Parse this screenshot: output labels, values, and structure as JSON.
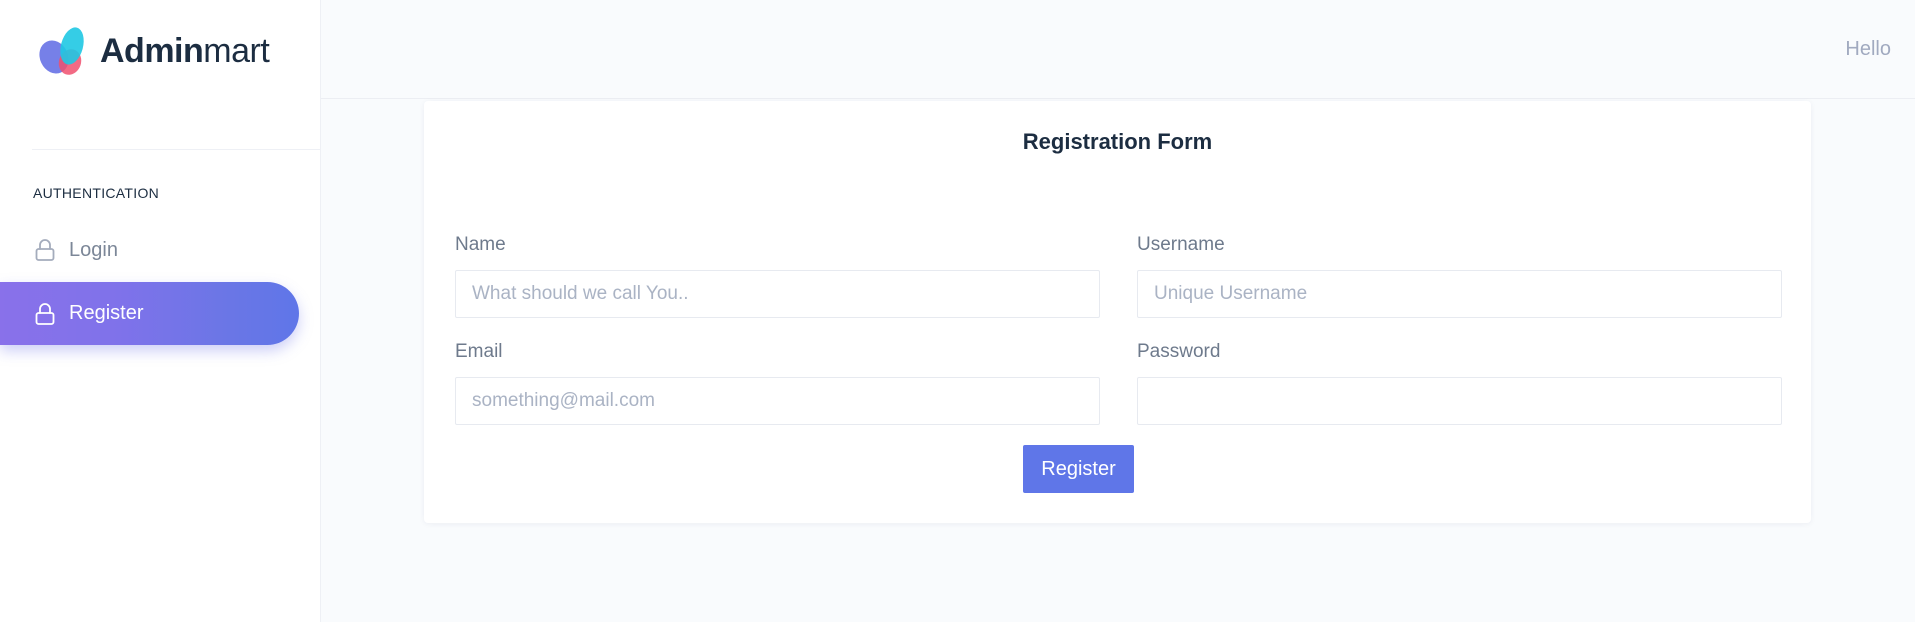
{
  "brand": {
    "name_bold": "Admin",
    "name_light": "mart"
  },
  "sidebar": {
    "heading": "AUTHENTICATION",
    "items": [
      {
        "label": "Login",
        "icon": "lock-icon",
        "active": false
      },
      {
        "label": "Register",
        "icon": "lock-icon",
        "active": true
      }
    ]
  },
  "topbar": {
    "greeting": "Hello"
  },
  "form": {
    "title": "Registration Form",
    "fields": {
      "name": {
        "label": "Name",
        "placeholder": "What should we call You..",
        "value": ""
      },
      "username": {
        "label": "Username",
        "placeholder": "Unique Username",
        "value": ""
      },
      "email": {
        "label": "Email",
        "placeholder": "something@mail.com",
        "value": ""
      },
      "password": {
        "label": "Password",
        "placeholder": "",
        "value": ""
      }
    },
    "submit_label": "Register"
  },
  "colors": {
    "accent": "#5f76e8",
    "gradient_start": "#8971ea",
    "text_dark": "#1c2d41",
    "text_muted": "#7c8798"
  }
}
